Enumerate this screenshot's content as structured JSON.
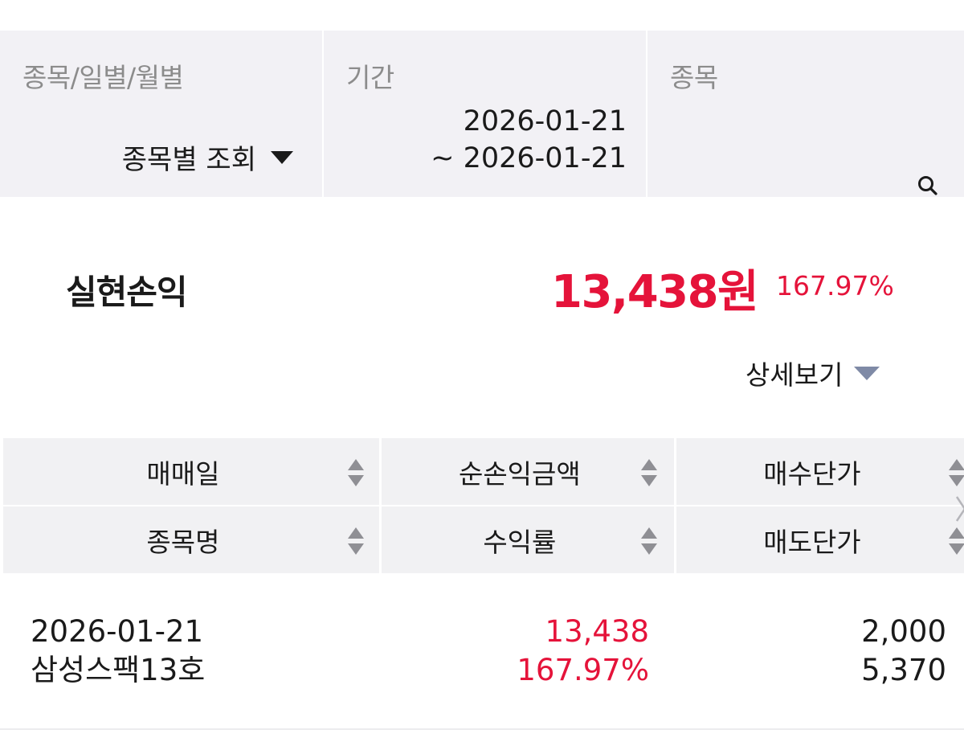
{
  "filters": {
    "type_label": "종목/일별/월별",
    "type_value": "종목별 조회",
    "period_label": "기간",
    "period_start": "2026-01-21",
    "period_end": "~ 2026-01-21",
    "item_label": "종목",
    "search_icon": "search-icon"
  },
  "summary": {
    "title": "실현손익",
    "amount": "13,438원",
    "rate": "167.97%",
    "detail_label": "상세보기"
  },
  "table": {
    "headers_row1": [
      "매매일",
      "순손익금액",
      "매수단가"
    ],
    "headers_row2": [
      "종목명",
      "수익률",
      "매도단가"
    ],
    "rows": [
      {
        "trade_date": "2026-01-21",
        "stock_name": "삼성스팩13호",
        "net_profit": "13,438",
        "return_rate": "167.97%",
        "buy_price": "2,000",
        "sell_price": "5,370"
      }
    ]
  },
  "colors": {
    "profit_red": "#e5133a",
    "header_bg": "#f1f1f3",
    "filter_bg": "#f2f1f5",
    "toggle_triangle": "#7f8aa6"
  }
}
